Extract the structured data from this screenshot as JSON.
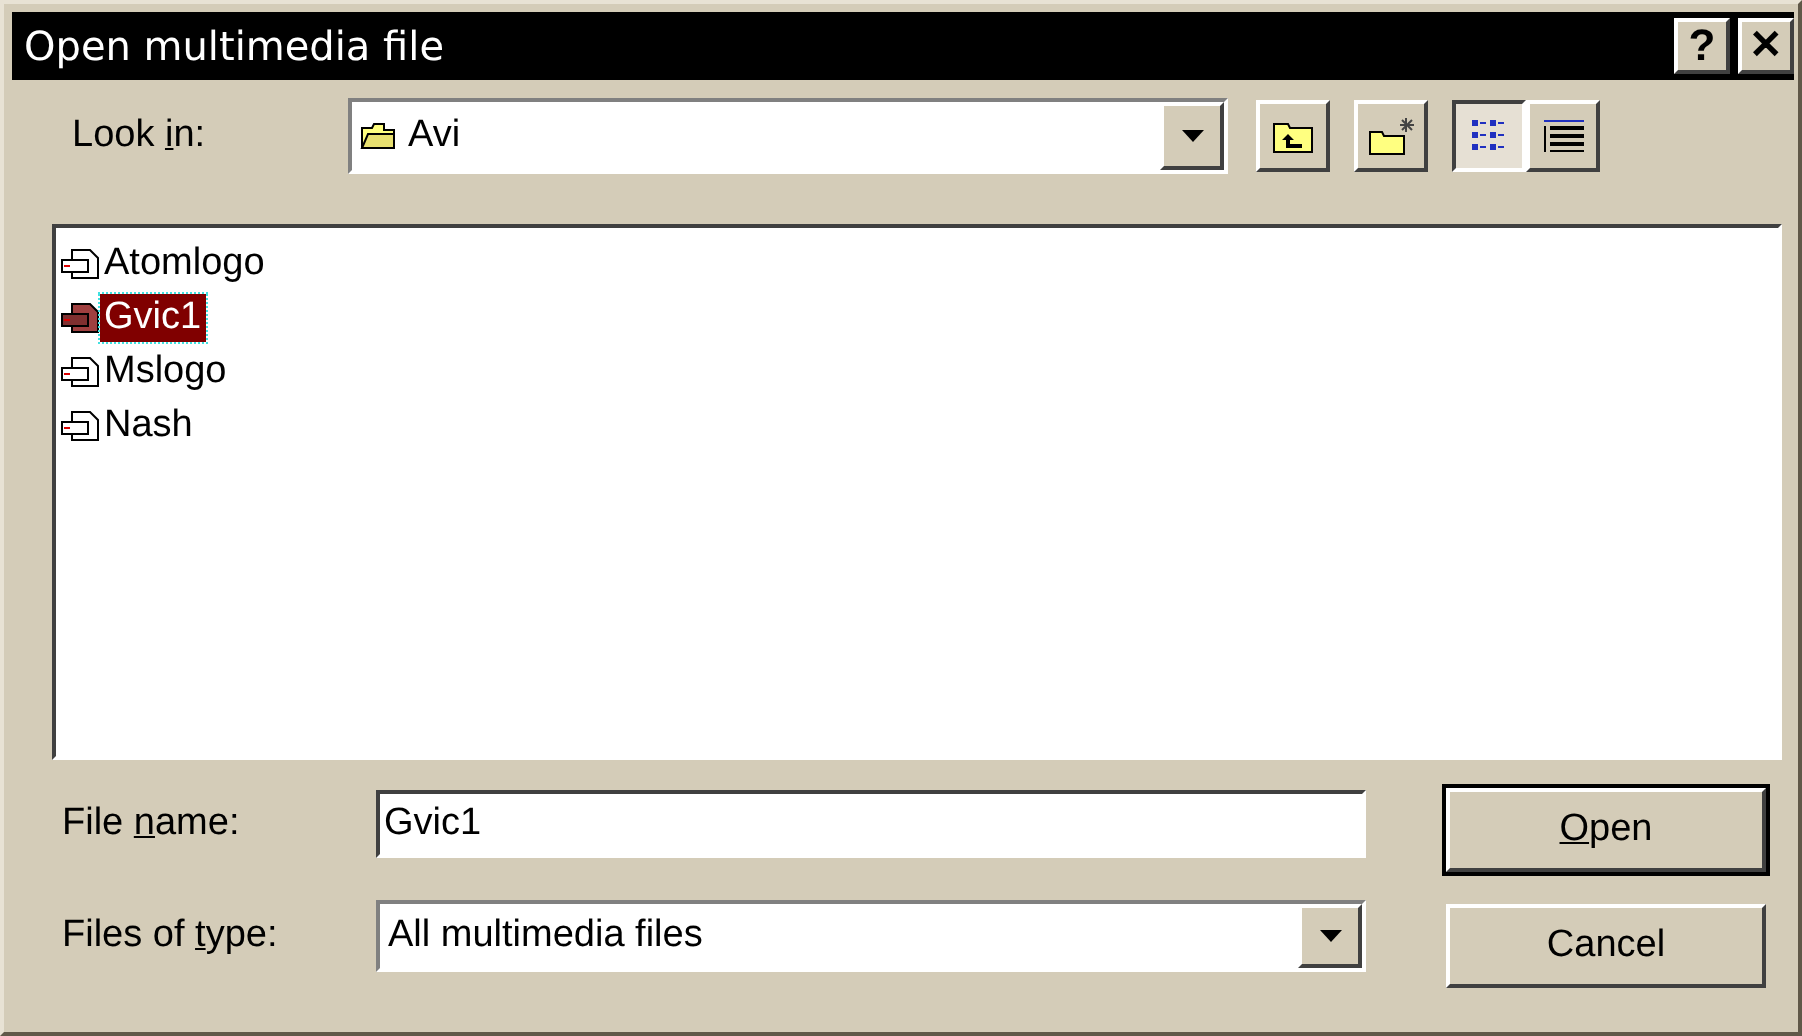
{
  "window": {
    "title": "Open multimedia file",
    "buttons": [
      {
        "kind": "help",
        "label": "?"
      },
      {
        "kind": "close",
        "label": "✕"
      }
    ]
  },
  "look_in": {
    "label": {
      "before": "Look ",
      "key": "i",
      "after": "n:"
    },
    "value": "Avi"
  },
  "toolbar": [
    {
      "kind": "up-folder",
      "selected": false
    },
    {
      "kind": "new-folder",
      "selected": false
    },
    {
      "kind": "list-view",
      "selected": true
    },
    {
      "kind": "details-view",
      "selected": false
    }
  ],
  "files": [
    {
      "name": "Atomlogo",
      "selected": false
    },
    {
      "name": "Gvic1",
      "selected": true
    },
    {
      "name": "Mslogo",
      "selected": false
    },
    {
      "name": "Nash",
      "selected": false
    }
  ],
  "file_name": {
    "label": {
      "before": "File ",
      "key": "n",
      "after": "ame:"
    },
    "value": "Gvic1"
  },
  "file_type": {
    "label": {
      "before": "Files of ",
      "key": "t",
      "after": "ype:"
    },
    "value": "All multimedia files"
  },
  "buttons": [
    {
      "label": {
        "key": "O",
        "after": "pen"
      },
      "default": true
    },
    {
      "label": {
        "before": "Cancel"
      },
      "default": false
    }
  ]
}
